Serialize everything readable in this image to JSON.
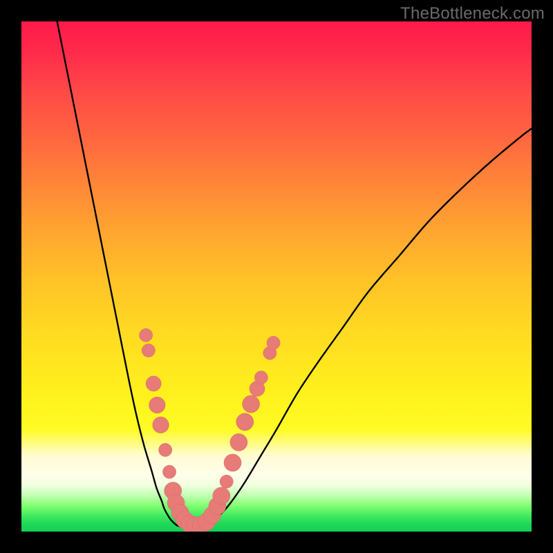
{
  "watermark": "TheBottleneck.com",
  "colors": {
    "curve": "#000000",
    "marker_fill": "#e77b78",
    "marker_stroke": "#d86a67"
  },
  "chart_data": {
    "type": "line",
    "title": "",
    "xlabel": "",
    "ylabel": "",
    "xlim": [
      0,
      100
    ],
    "ylim": [
      0,
      100
    ],
    "series": [
      {
        "name": "left-branch",
        "x": [
          7,
          9,
          11,
          13,
          15,
          17,
          19,
          21,
          22.5,
          24,
          25.5,
          26.5,
          27.5,
          28,
          28.7,
          29.3,
          30,
          30.5
        ],
        "y": [
          100,
          90,
          80,
          70,
          60,
          50,
          40,
          30,
          23,
          17,
          12,
          8.5,
          6,
          4.5,
          3.2,
          2.3,
          1.6,
          1.2
        ]
      },
      {
        "name": "trough",
        "x": [
          30.5,
          31.5,
          32.5,
          33.5,
          34.5,
          35.5,
          36.5
        ],
        "y": [
          1.2,
          0.9,
          0.8,
          0.8,
          0.9,
          1.1,
          1.5
        ]
      },
      {
        "name": "right-branch",
        "x": [
          36.5,
          38,
          40,
          42,
          44,
          47,
          50,
          54,
          58,
          63,
          68,
          74,
          80,
          86,
          92,
          98,
          100
        ],
        "y": [
          1.5,
          2.5,
          4.4,
          7,
          10,
          15,
          20,
          27,
          33,
          40,
          47,
          54,
          61,
          67,
          72.5,
          77.5,
          79
        ]
      }
    ],
    "markers": [
      {
        "x": 24.4,
        "y": 38.5,
        "r": 1.3
      },
      {
        "x": 24.9,
        "y": 35.5,
        "r": 1.3
      },
      {
        "x": 25.9,
        "y": 29.0,
        "r": 1.5
      },
      {
        "x": 26.6,
        "y": 24.8,
        "r": 1.6
      },
      {
        "x": 27.3,
        "y": 20.9,
        "r": 1.6
      },
      {
        "x": 28.2,
        "y": 16.0,
        "r": 1.3
      },
      {
        "x": 29.0,
        "y": 11.7,
        "r": 1.3
      },
      {
        "x": 29.7,
        "y": 8.0,
        "r": 1.7
      },
      {
        "x": 30.3,
        "y": 5.6,
        "r": 1.7
      },
      {
        "x": 31.1,
        "y": 3.7,
        "r": 1.7
      },
      {
        "x": 32.0,
        "y": 2.3,
        "r": 1.7
      },
      {
        "x": 33.0,
        "y": 1.5,
        "r": 1.7
      },
      {
        "x": 34.1,
        "y": 1.2,
        "r": 1.7
      },
      {
        "x": 35.2,
        "y": 1.3,
        "r": 1.7
      },
      {
        "x": 36.3,
        "y": 1.9,
        "r": 1.7
      },
      {
        "x": 37.4,
        "y": 3.2,
        "r": 1.7
      },
      {
        "x": 38.4,
        "y": 5.0,
        "r": 1.7
      },
      {
        "x": 39.2,
        "y": 7.0,
        "r": 1.7
      },
      {
        "x": 40.2,
        "y": 9.8,
        "r": 1.3
      },
      {
        "x": 41.4,
        "y": 13.5,
        "r": 1.7
      },
      {
        "x": 42.6,
        "y": 17.5,
        "r": 1.7
      },
      {
        "x": 43.8,
        "y": 21.5,
        "r": 1.7
      },
      {
        "x": 45.0,
        "y": 25.0,
        "r": 1.7
      },
      {
        "x": 46.2,
        "y": 28.0,
        "r": 1.5
      },
      {
        "x": 47.0,
        "y": 30.2,
        "r": 1.3
      },
      {
        "x": 48.7,
        "y": 35.0,
        "r": 1.3
      },
      {
        "x": 49.4,
        "y": 37.0,
        "r": 1.3
      }
    ]
  }
}
